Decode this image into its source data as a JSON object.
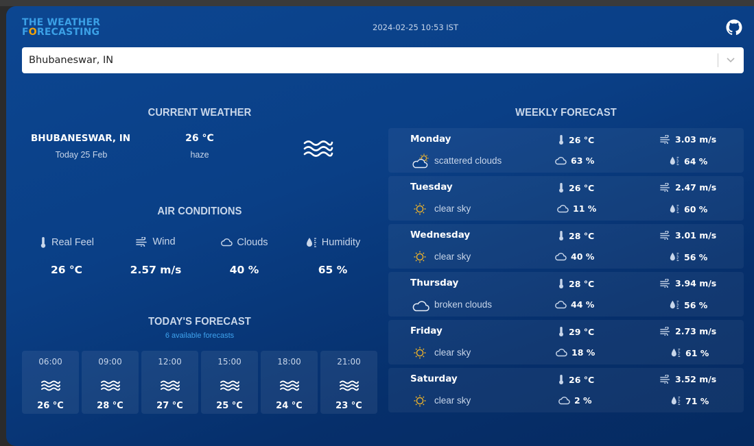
{
  "header": {
    "logo_line1": "THE WEATHER",
    "logo_line2_pre": "F",
    "logo_line2_o": "O",
    "logo_line2_post": "RECASTING",
    "datetime": "2024-02-25 10:53 IST"
  },
  "search": {
    "value": "Bhubaneswar, IN"
  },
  "current_weather": {
    "title": "CURRENT WEATHER",
    "city": "BHUBANESWAR, IN",
    "date": "Today 25 Feb",
    "temp": "26 °C",
    "description": "haze",
    "icon": "haze-icon"
  },
  "air_conditions": {
    "title": "AIR CONDITIONS",
    "items": [
      {
        "label": "Real Feel",
        "value": "26 °C",
        "icon": "thermometer-icon"
      },
      {
        "label": "Wind",
        "value": "2.57 m/s",
        "icon": "wind-icon"
      },
      {
        "label": "Clouds",
        "value": "40 %",
        "icon": "cloud-icon"
      },
      {
        "label": "Humidity",
        "value": "65 %",
        "icon": "humidity-icon"
      }
    ]
  },
  "todays_forecast": {
    "title": "TODAY'S FORECAST",
    "subtitle": "6 available forecasts",
    "items": [
      {
        "time": "06:00",
        "temp": "26 °C",
        "icon": "haze-icon"
      },
      {
        "time": "09:00",
        "temp": "28 °C",
        "icon": "haze-icon"
      },
      {
        "time": "12:00",
        "temp": "27 °C",
        "icon": "haze-icon"
      },
      {
        "time": "15:00",
        "temp": "25 °C",
        "icon": "haze-icon"
      },
      {
        "time": "18:00",
        "temp": "24 °C",
        "icon": "haze-icon"
      },
      {
        "time": "21:00",
        "temp": "23 °C",
        "icon": "haze-icon"
      }
    ]
  },
  "weekly_forecast": {
    "title": "WEEKLY FORECAST",
    "days": [
      {
        "day": "Monday",
        "description": "scattered clouds",
        "icon": "partly-cloudy-icon",
        "temp": "26 °C",
        "wind": "3.03 m/s",
        "clouds": "63 %",
        "humidity": "64 %"
      },
      {
        "day": "Tuesday",
        "description": "clear sky",
        "icon": "sun-icon",
        "temp": "26 °C",
        "wind": "2.47 m/s",
        "clouds": "11 %",
        "humidity": "60 %"
      },
      {
        "day": "Wednesday",
        "description": "clear sky",
        "icon": "sun-icon",
        "temp": "28 °C",
        "wind": "3.01 m/s",
        "clouds": "40 %",
        "humidity": "56 %"
      },
      {
        "day": "Thursday",
        "description": "broken clouds",
        "icon": "cloud-icon",
        "temp": "28 °C",
        "wind": "3.94 m/s",
        "clouds": "44 %",
        "humidity": "56 %"
      },
      {
        "day": "Friday",
        "description": "clear sky",
        "icon": "sun-icon",
        "temp": "29 °C",
        "wind": "2.73 m/s",
        "clouds": "18 %",
        "humidity": "61 %"
      },
      {
        "day": "Saturday",
        "description": "clear sky",
        "icon": "sun-icon",
        "temp": "26 °C",
        "wind": "3.52 m/s",
        "clouds": "2 %",
        "humidity": "71 %"
      }
    ]
  },
  "colors": {
    "background": "#0a3f86",
    "accent": "#3ba0e6",
    "logo_highlight": "#f0a30a",
    "sun": "#f0b429",
    "muted_text": "#c8d6ea"
  }
}
